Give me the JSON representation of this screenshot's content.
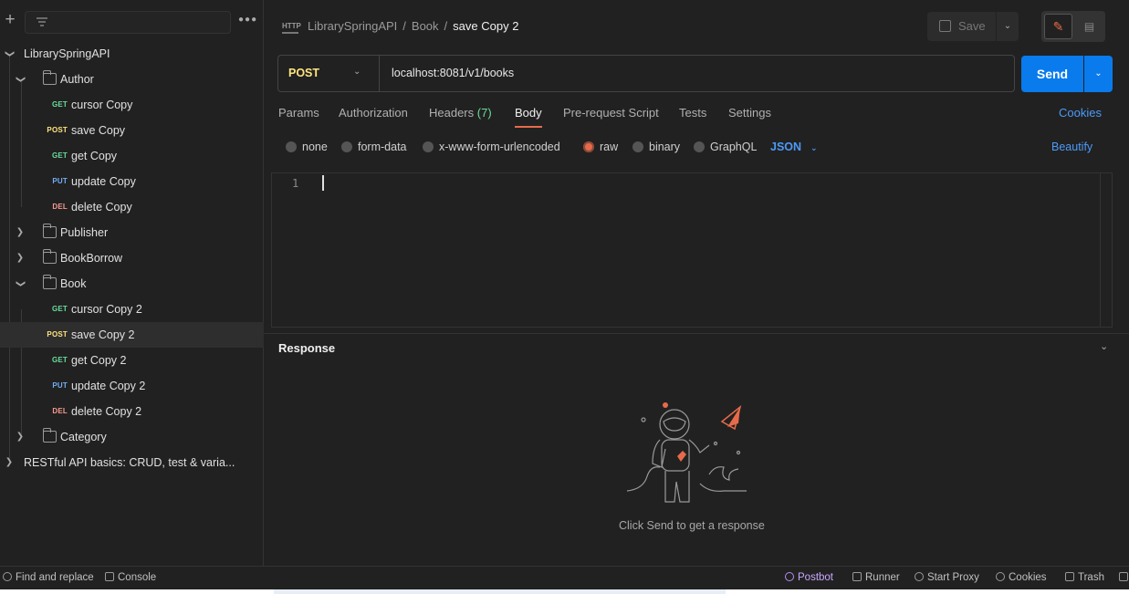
{
  "sidebar": {
    "more_label": "●●●",
    "tree": [
      {
        "type": "collection",
        "label": "LibrarySpringAPI",
        "expanded": true
      },
      {
        "type": "folder",
        "label": "Author",
        "expanded": true
      },
      {
        "type": "request",
        "method": "GET",
        "label": "cursor Copy"
      },
      {
        "type": "request",
        "method": "POST",
        "label": "save Copy"
      },
      {
        "type": "request",
        "method": "GET",
        "label": "get Copy"
      },
      {
        "type": "request",
        "method": "PUT",
        "label": "update Copy"
      },
      {
        "type": "request",
        "method": "DEL",
        "label": "delete Copy"
      },
      {
        "type": "folder",
        "label": "Publisher",
        "expanded": false
      },
      {
        "type": "folder",
        "label": "BookBorrow",
        "expanded": false
      },
      {
        "type": "folder",
        "label": "Book",
        "expanded": true
      },
      {
        "type": "request",
        "method": "GET",
        "label": "cursor Copy 2"
      },
      {
        "type": "request",
        "method": "POST",
        "label": "save Copy 2",
        "selected": true
      },
      {
        "type": "request",
        "method": "GET",
        "label": "get Copy 2"
      },
      {
        "type": "request",
        "method": "PUT",
        "label": "update Copy 2"
      },
      {
        "type": "request",
        "method": "DEL",
        "label": "delete Copy 2"
      },
      {
        "type": "folder",
        "label": "Category",
        "expanded": false
      },
      {
        "type": "collection",
        "label": "RESTful API basics: CRUD, test & varia...",
        "expanded": false
      }
    ]
  },
  "header": {
    "http_icon": "HTTP",
    "breadcrumb": [
      "LibrarySpringAPI",
      "Book",
      "save Copy 2"
    ],
    "save_label": "Save"
  },
  "request": {
    "method": "POST",
    "url": "localhost:8081/v1/books",
    "send_label": "Send"
  },
  "tabs": {
    "items": [
      "Params",
      "Authorization",
      "Headers",
      "Body",
      "Pre-request Script",
      "Tests",
      "Settings"
    ],
    "headers_count": "(7)",
    "active": "Body",
    "cookies": "Cookies"
  },
  "body": {
    "types": [
      "none",
      "form-data",
      "x-www-form-urlencoded",
      "raw",
      "binary",
      "GraphQL"
    ],
    "selected": "raw",
    "format": "JSON",
    "beautify": "Beautify",
    "line_number": "1"
  },
  "response": {
    "title": "Response",
    "hint": "Click Send to get a response"
  },
  "statusbar": {
    "find_replace": "Find and replace",
    "console": "Console",
    "postbot": "Postbot",
    "runner": "Runner",
    "start_proxy": "Start Proxy",
    "cookies": "Cookies",
    "trash": "Trash"
  },
  "colors": {
    "background": "#212121",
    "accent": "#e66b4a",
    "send_blue": "#097bed",
    "link_blue": "#4d9af8",
    "get": "#6bdd9a",
    "post": "#ffe47e",
    "put": "#74aef6",
    "delete": "#f79a8e"
  }
}
